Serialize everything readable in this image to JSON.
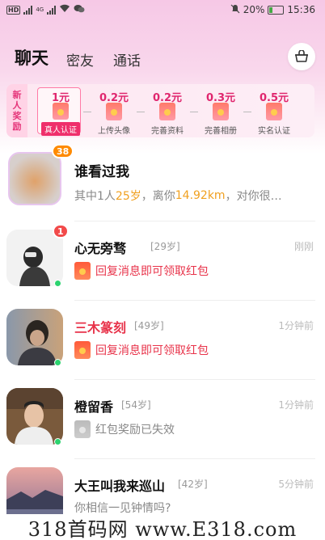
{
  "status_bar": {
    "network": "4G",
    "battery": "20%",
    "time": "15:36"
  },
  "tabs": [
    {
      "label": "聊天",
      "active": true
    },
    {
      "label": "密友",
      "active": false
    },
    {
      "label": "通话",
      "active": false
    }
  ],
  "reward_banner": {
    "title": "新人奖励",
    "steps": [
      {
        "amount": "1元",
        "label": "真人认证",
        "done": true
      },
      {
        "amount": "0.2元",
        "label": "上传头像",
        "done": false
      },
      {
        "amount": "0.2元",
        "label": "完善资料",
        "done": false
      },
      {
        "amount": "0.3元",
        "label": "完善相册",
        "done": false
      },
      {
        "amount": "0.5元",
        "label": "实名认证",
        "done": false
      }
    ]
  },
  "visitors": {
    "title": "谁看过我",
    "count_badge": "38",
    "summary_prefix": "其中1人",
    "age": "25岁",
    "distance_prefix": "，离你",
    "distance": "14.92km",
    "summary_suffix": "，对你很…"
  },
  "chats": [
    {
      "name": "心无旁骛",
      "name_color": "#111111",
      "age": "[29岁]",
      "time": "刚刚",
      "unread": "1",
      "message": "回复消息即可领取红包",
      "message_type": "redpacket",
      "online": true
    },
    {
      "name": "三木篆刻",
      "name_color": "#e8334a",
      "age": "[49岁]",
      "time": "1分钟前",
      "unread": "",
      "message": "回复消息即可领取红包",
      "message_type": "redpacket",
      "online": true
    },
    {
      "name": "橙留香",
      "name_color": "#111111",
      "age": "[54岁]",
      "time": "1分钟前",
      "unread": "",
      "message": "红包奖励已失效",
      "message_type": "expired",
      "online": true
    },
    {
      "name": "大王叫我来巡山",
      "name_color": "#111111",
      "age": "[42岁]",
      "time": "5分钟前",
      "unread": "",
      "message": "你相信一见钟情吗?",
      "message_type": "text",
      "online": true
    }
  ],
  "watermark": "318首码网 www.E318.com"
}
